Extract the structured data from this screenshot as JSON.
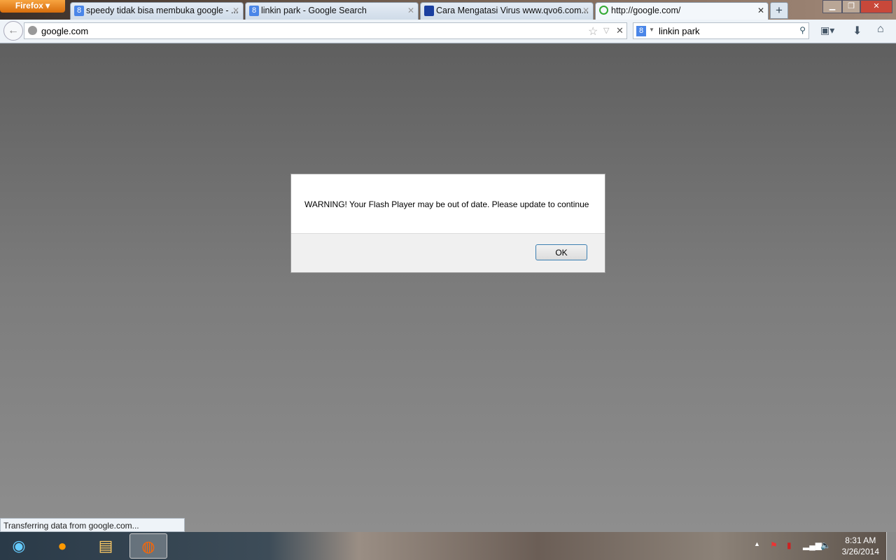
{
  "browser": {
    "menu_button": "Firefox",
    "tabs": [
      {
        "title": "speedy tidak bisa membuka google - ...",
        "icon": "google-icon"
      },
      {
        "title": "linkin park - Google Search",
        "icon": "google-icon"
      },
      {
        "title": "Cara Mengatasi Virus www.qvo6.com...",
        "icon": "site-icon"
      },
      {
        "title": "http://google.com/",
        "icon": "loading-icon",
        "active": true
      }
    ],
    "new_tab": "+",
    "url": "google.com",
    "search_value": "linkin park"
  },
  "dialog": {
    "message": "WARNING! Your Flash Player may be out of date. Please update to continue",
    "ok_label": "OK"
  },
  "status_text": "Transferring data from google.com...",
  "taskbar": {
    "time": "8:31 AM",
    "date": "3/26/2014"
  }
}
